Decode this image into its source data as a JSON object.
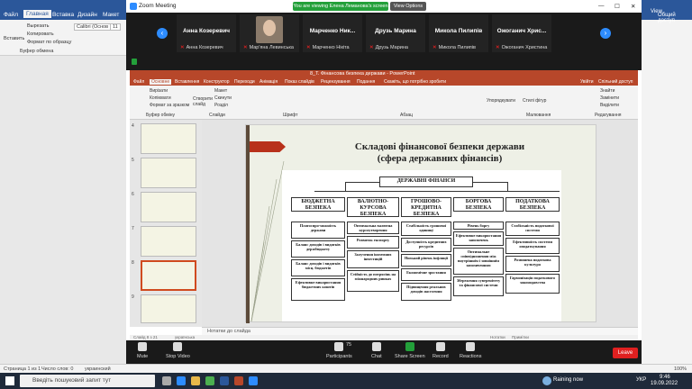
{
  "word": {
    "tabs": [
      "Файл",
      "Главная",
      "Вставка",
      "Дизайн",
      "Макет"
    ],
    "clipboard": [
      "Вставить",
      "Вырезать",
      "Копировать",
      "Формат по образцу"
    ],
    "clipboard_group": "Буфер обмена",
    "font_name": "Calibri (Основ",
    "font_size": "11",
    "right_items": [
      "View",
      "Общий доступ"
    ],
    "status": [
      "Страница 1 из 1",
      "Число слов: 0",
      "украинский"
    ],
    "zoom_level": "100%"
  },
  "zoom": {
    "window_title": "Zoom Meeting",
    "banner": "You are viewing Елена Леманова's screen",
    "view_options": "View Options",
    "participants": [
      {
        "name": "Анна Козеревич",
        "sub": "Анна Козеревич"
      },
      {
        "name": "",
        "sub": "Мар'яна Левинська"
      },
      {
        "name": "Марченко Ник...",
        "sub": "Марченко Нікіта"
      },
      {
        "name": "Друзь Марина",
        "sub": "Друзь Марина"
      },
      {
        "name": "Микола Пилипів",
        "sub": "Микола Пилипів"
      },
      {
        "name": "Ожоганич Хрис...",
        "sub": "Ожоганич Христина"
      }
    ],
    "controls": [
      {
        "label": "Mute",
        "icon": "mic-icon"
      },
      {
        "label": "Stop Video",
        "icon": "video-icon"
      },
      {
        "label": "Participants",
        "icon": "participants-icon",
        "count": "75"
      },
      {
        "label": "Chat",
        "icon": "chat-icon"
      },
      {
        "label": "Share Screen",
        "icon": "share-screen-icon"
      },
      {
        "label": "Record",
        "icon": "record-icon"
      },
      {
        "label": "Reactions",
        "icon": "reactions-icon"
      }
    ],
    "leave": "Leave",
    "colors": {
      "accent": "#2d8cff",
      "share": "#23a03a",
      "leave": "#e02020"
    }
  },
  "ppt": {
    "title": "8_Т. Фінансова безпека держави - PowerPoint",
    "tabs": [
      "Файл",
      "Основне",
      "Вставлення",
      "Конструктор",
      "Переходи",
      "Анімація",
      "Показ слайдів",
      "Рецензування",
      "Подання"
    ],
    "tell_me": "Скажіть, що потрібно зробити",
    "right_tabs": [
      "Увійти",
      "Спільний доступ"
    ],
    "ribbon": [
      "Вирізати",
      "Копіювати",
      "Формат за зразком",
      "Створити слайд",
      "Макет",
      "Скинути",
      "Розділ",
      "Упорядкувати",
      "Стилі фігур",
      "Знайти",
      "Замінити",
      "Виділити"
    ],
    "ribbon_groups": [
      "Буфер обміну",
      "Слайди",
      "Шрифт",
      "Абзац",
      "Малювання",
      "Редагування"
    ],
    "slide_numbers": [
      "4",
      "5",
      "6",
      "7",
      "8",
      "9"
    ],
    "notes": "Нотатки до слайда",
    "status": [
      "Слайд 8 з 21",
      "українська",
      "Нотатки",
      "Примітки"
    ]
  },
  "slide": {
    "title_line1": "Складові фінансової безпеки держави",
    "title_line2": "(сфера державних фінансів)",
    "root": "ДЕРЖАВНІ ФІНАНСИ",
    "columns": [
      {
        "header": "БЮДЖЕТНА БЕЗПЕКА",
        "items": [
          "Платоспро-можність держави",
          "Баланс доходів і видатків держбюджету",
          "Баланс доходів і видатків місц. бюджетів",
          "Ефективне використання бюджетних коштів"
        ]
      },
      {
        "header": "ВАЛЮТНО-КУРСОВА БЕЗПЕКА",
        "items": [
          "Оптимальна валютна курсоутворення",
          "Розвиток експорту",
          "Залучення іноземних інвестицій",
          "Стійкість до потрясінь на міжнародних ринках"
        ]
      },
      {
        "header": "ГРОШОВО-КРЕДИТНА БЕЗПЕКА",
        "items": [
          "Стабільність грошової одиниці",
          "Доступність кредитних ресурсів",
          "Низький рівень інфляції",
          "Економічне зростання",
          "Підвищення реальних доходів населення"
        ]
      },
      {
        "header": "БОРГОВА БЕЗПЕКА",
        "items": [
          "Рівень боргу",
          "Ефективне використання запозичень",
          "Оптимальне співвідношення між внутрішнім і зовнішнім запозиченням",
          "Збереження суверенітету та фінансової системи"
        ]
      },
      {
        "header": "ПОДАТКОВА БЕЗПЕКА",
        "items": [
          "Стабільність податкової системи",
          "Ефективність системи оподаткування",
          "Розвинена податкова культура",
          "Гармонізація податкового законодавства"
        ]
      }
    ]
  },
  "taskbar": {
    "search_placeholder": "Введіть пошуковий запит тут",
    "weather": "Raining now",
    "time": "9:46",
    "date": "19.09.2022",
    "lang": "УКР"
  }
}
